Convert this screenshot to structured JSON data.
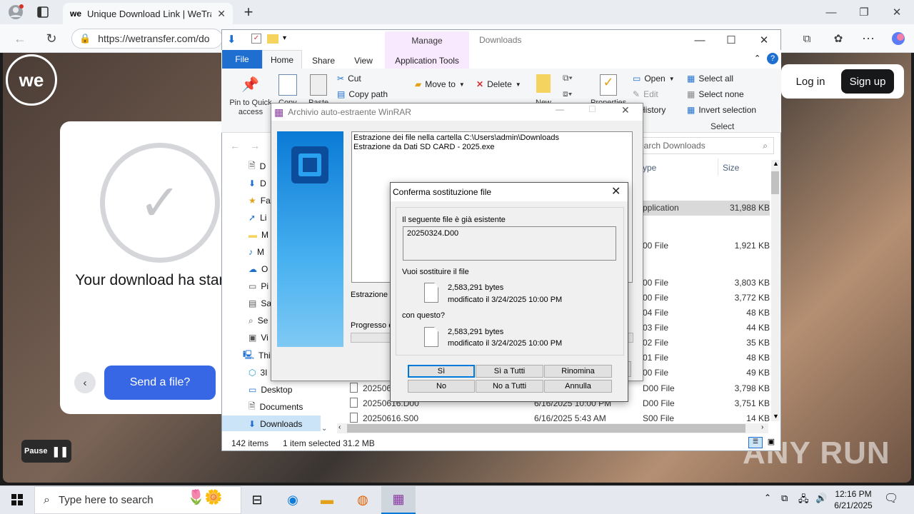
{
  "browser": {
    "tab_title": "Unique Download Link | WeTransf",
    "tab_favicon": "we",
    "url": "https://wetransfer.com/do",
    "new_tab_symbol": "+"
  },
  "page": {
    "logo_text": "we",
    "download_title": "Your download ha started",
    "send_button": "Send a file?",
    "login": "Log in",
    "signup": "Sign up",
    "pause": "Pause",
    "watermark": "ANY RUN"
  },
  "explorer": {
    "title": "Downloads",
    "manage_tab": "Manage",
    "tabs": [
      "File",
      "Home",
      "Share",
      "View",
      "Application Tools"
    ],
    "clipboard": {
      "pin": "Pin to Quick access",
      "copy": "Copy",
      "paste": "Paste",
      "cut": "Cut",
      "copy_path": "Copy path"
    },
    "organize": {
      "move_to": "Move to",
      "delete": "Delete"
    },
    "new": "New",
    "properties": "Properties",
    "open_group": {
      "open": "Open",
      "edit": "Edit",
      "history": "History"
    },
    "select_group": {
      "select_all": "Select all",
      "select_none": "Select none",
      "invert": "Invert selection",
      "label": "Select"
    },
    "search_placeholder": "earch Downloads",
    "columns": {
      "type": "ype",
      "size": "Size"
    },
    "nav_items": [
      {
        "icon": "document-icon",
        "label": "D"
      },
      {
        "icon": "download-icon",
        "label": "D"
      },
      {
        "icon": "star-icon",
        "label": "Fa"
      },
      {
        "icon": "link-icon",
        "label": "Li"
      },
      {
        "icon": "folder-icon",
        "label": "M"
      },
      {
        "icon": "music-icon",
        "label": "M"
      },
      {
        "icon": "cloud-icon",
        "label": "O"
      },
      {
        "icon": "picture-icon",
        "label": "Pi"
      },
      {
        "icon": "save-icon",
        "label": "Sa"
      },
      {
        "icon": "search-icon",
        "label": "Se"
      },
      {
        "icon": "video-icon",
        "label": "Vi"
      }
    ],
    "this_pc": "Thi",
    "nav_lower": [
      {
        "icon": "3d-icon",
        "label": "3I"
      },
      {
        "icon": "desktop-icon",
        "label": "Desktop"
      },
      {
        "icon": "documents-icon",
        "label": "Documents"
      },
      {
        "icon": "downloads-icon",
        "label": "Downloads"
      }
    ],
    "rows": [
      {
        "name": "",
        "date": "",
        "type": "pplication",
        "size": "31,988 KB"
      },
      {
        "name": "",
        "date": "",
        "type": "00 File",
        "size": "1,921 KB"
      },
      {
        "name": "",
        "date": "",
        "type": "00 File",
        "size": "3,803 KB"
      },
      {
        "name": "",
        "date": "",
        "type": "00 File",
        "size": "3,772 KB"
      },
      {
        "name": "",
        "date": "",
        "type": "04 File",
        "size": "48 KB"
      },
      {
        "name": "",
        "date": "",
        "type": "03 File",
        "size": "44 KB"
      },
      {
        "name": "",
        "date": "",
        "type": "02 File",
        "size": "35 KB"
      },
      {
        "name": "",
        "date": "",
        "type": "01 File",
        "size": "48 KB"
      },
      {
        "name": "",
        "date": "",
        "type": "00 File",
        "size": "49 KB"
      },
      {
        "name": "2025061",
        "date": "6/16/2025 10:00 PM",
        "type": "D00 File",
        "size": "3,798 KB"
      },
      {
        "name": "20250616.D00",
        "date": "6/16/2025 10:00 PM",
        "type": "D00 File",
        "size": "3,751 KB"
      },
      {
        "name": "20250616.S00",
        "date": "6/16/2025 5:43 AM",
        "type": "S00 File",
        "size": "14 KB"
      }
    ],
    "status_items": "142 items",
    "status_selected": "1 item selected  31.2 MB"
  },
  "winrar": {
    "title": "Archivio auto-estraente WinRAR",
    "log_line1": "Estrazione dei file nella cartella C:\\Users\\admin\\Downloads",
    "log_line2": "Estrazione da Dati SD CARD - 2025.exe",
    "extract_label": "Estrazione d",
    "progress_label": "Progresso e"
  },
  "confirm": {
    "title": "Conferma sostituzione file",
    "exists_label": "Il seguente file è già esistente",
    "filename": "20250324.D00",
    "replace_label": "Vuoi sostituire il file",
    "old_size": "2,583,291 bytes",
    "old_modified": "modificato il 3/24/2025 10:00 PM",
    "with_label": "con questo?",
    "new_size": "2,583,291 bytes",
    "new_modified": "modificato il 3/24/2025 10:00 PM",
    "buttons": [
      "Sì",
      "Sì a Tutti",
      "Rinomina",
      "No",
      "No a Tutti",
      "Annulla"
    ]
  },
  "taskbar": {
    "search_placeholder": "Type here to search",
    "time": "12:16 PM",
    "date": "6/21/2025"
  }
}
